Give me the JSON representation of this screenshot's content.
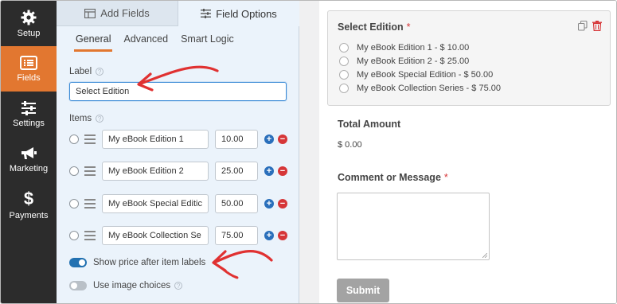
{
  "nav": {
    "items": [
      {
        "label": "Setup",
        "icon": "gear-icon",
        "active": false
      },
      {
        "label": "Fields",
        "icon": "fields-list-icon",
        "active": true
      },
      {
        "label": "Settings",
        "icon": "sliders-icon",
        "active": false
      },
      {
        "label": "Marketing",
        "icon": "megaphone-icon",
        "active": false
      },
      {
        "label": "Payments",
        "icon": "dollar-icon",
        "active": false
      }
    ]
  },
  "panel": {
    "tabs": [
      {
        "label": "Add Fields",
        "icon": "table-icon"
      },
      {
        "label": "Field Options",
        "icon": "sliders-icon"
      }
    ],
    "subtabs": [
      "General",
      "Advanced",
      "Smart Logic"
    ],
    "label_caption": "Label",
    "label_value": "Select Edition",
    "items_caption": "Items",
    "items": [
      {
        "name": "My eBook Edition 1",
        "price": "10.00"
      },
      {
        "name": "My eBook Edition 2",
        "price": "25.00"
      },
      {
        "name": "My eBook Special Editic",
        "price": "50.00"
      },
      {
        "name": "My eBook Collection Se",
        "price": "75.00"
      }
    ],
    "toggle_show_price": {
      "label": "Show price after item labels",
      "on": true
    },
    "toggle_image_choices": {
      "label": "Use image choices",
      "on": false
    }
  },
  "preview": {
    "select_field": {
      "title": "Select Edition",
      "required_mark": "*",
      "choices": [
        "My eBook Edition 1 - $ 10.00",
        "My eBook Edition 2 - $ 25.00",
        "My eBook Special Edition - $ 50.00",
        "My eBook Collection Series - $ 75.00"
      ]
    },
    "total_label": "Total Amount",
    "total_value": "$ 0.00",
    "comment_label": "Comment or Message",
    "comment_required": "*",
    "submit_label": "Submit"
  },
  "colors": {
    "nav_bg": "#2c2c2c",
    "nav_active": "#e27730",
    "panel_bg": "#ebf3fb",
    "accent_blue": "#2271b1",
    "required_red": "#d63638",
    "arrow_red": "#e03131"
  }
}
